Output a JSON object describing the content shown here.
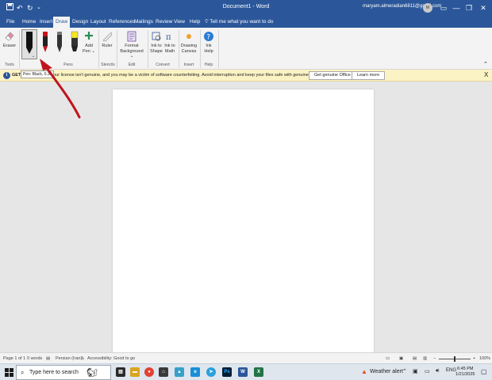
{
  "titlebar": {
    "title": "Document1 - Word",
    "user": "maryam.almeradian6811@gmail.com",
    "avatar_initials": "M",
    "minimize": "—",
    "restore": "❐",
    "close": "✕",
    "bg_color": "#2b579a"
  },
  "tabs": [
    "File",
    "Home",
    "Insert",
    "Draw",
    "Design",
    "Layout",
    "References",
    "Mailings",
    "Review",
    "View",
    "Help"
  ],
  "active_tab": "Draw",
  "tellme": "Tell me what you want to do",
  "ribbon": {
    "eraser": "Eraser",
    "add_pen": "Add Pen",
    "ruler": "Ruler",
    "format_background": "Format Background",
    "ink_to_shape": "Ink to Shape",
    "ink_to_math": "Ink to Math",
    "drawing_canvas": "Drawing Canvas",
    "ink_help": "Ink Help",
    "groups": {
      "tools": "Tools",
      "pens": "Pens",
      "stencils": "Stencils",
      "edit": "Edit",
      "convert": "Convert",
      "insert": "Insert",
      "help": "Help"
    }
  },
  "tooltip": "Pen: Black, 0.35",
  "message_bar": {
    "head": "GET",
    "text": "Your license isn't genuine, and you may be a victim of software counterfeiting. Avoid interruption and keep your files safe with genuine Office today.",
    "primary_button": "Get genuine Office",
    "secondary_button": "Learn more",
    "close": "X"
  },
  "statusbar": {
    "page": "Page 1 of 1",
    "words": "0 words",
    "language": "Persian (Iran)",
    "accessibility": "Accessibility: Good to go",
    "zoom": "100%"
  },
  "taskbar": {
    "search_placeholder": "Type here to search",
    "weather": "Weather alert",
    "time": "6:45 PM",
    "date": "1/21/2025"
  },
  "colors": {
    "word_blue": "#2b579a",
    "warning_bg": "#fcf3c4",
    "annotation_arrow": "#c0141c"
  }
}
